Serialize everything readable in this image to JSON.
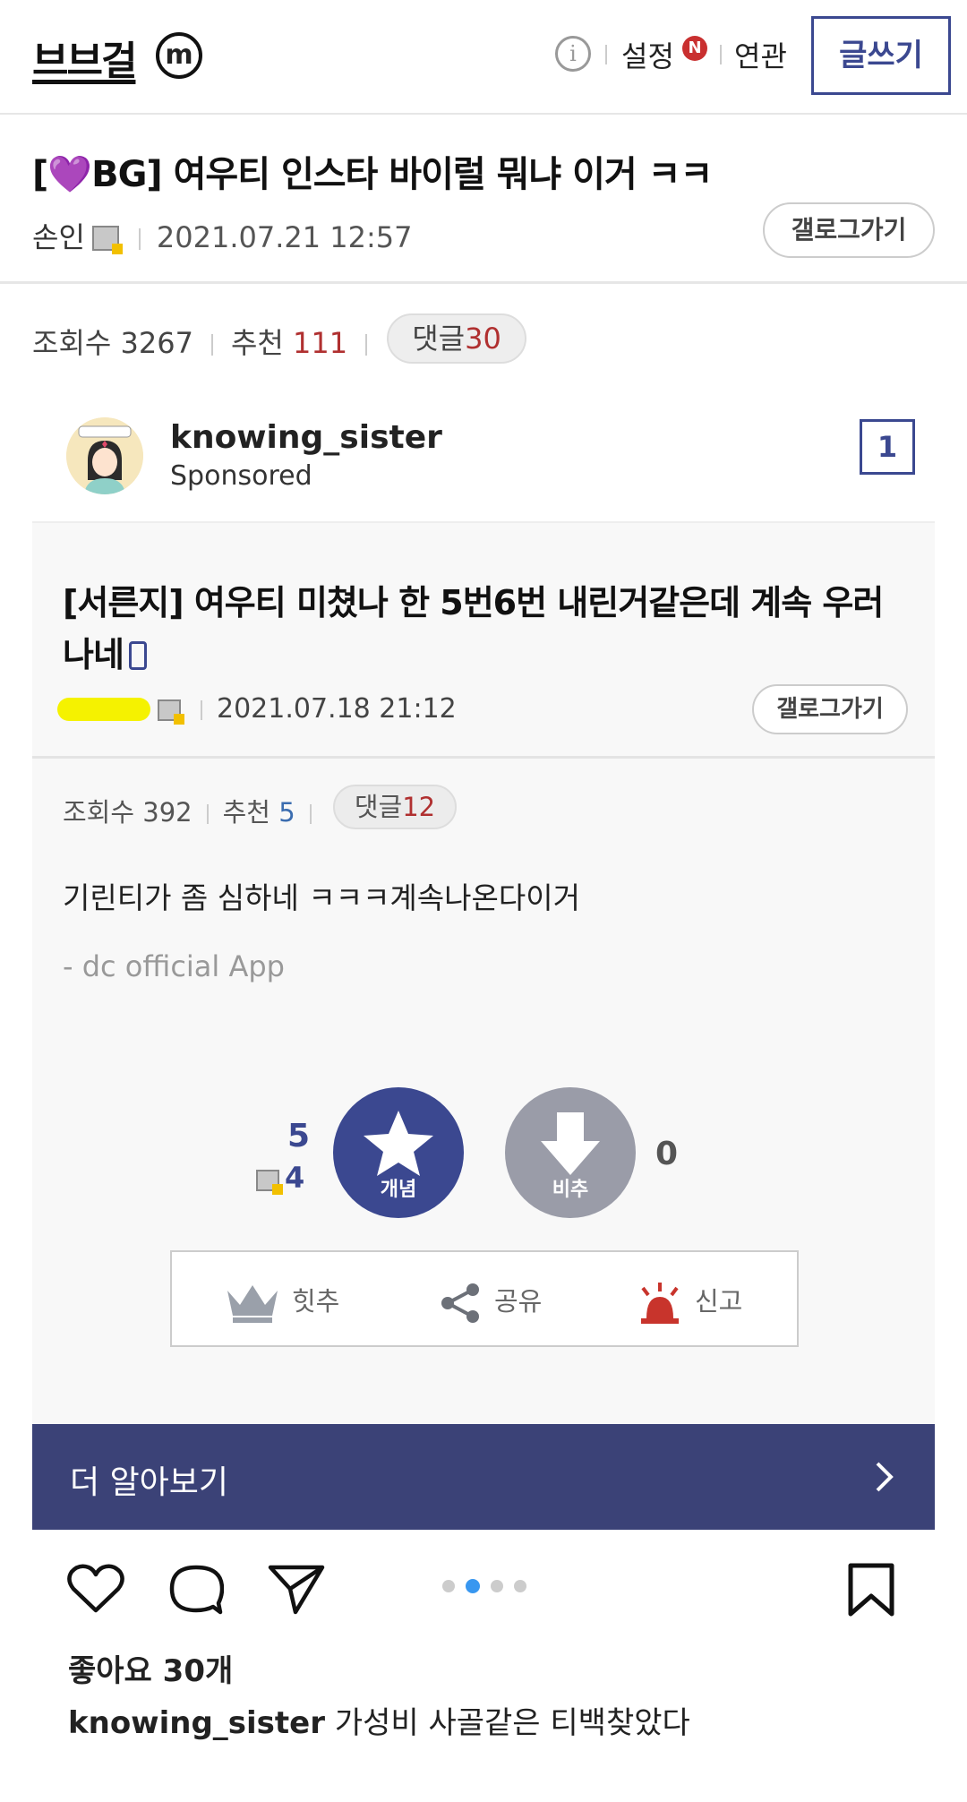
{
  "header": {
    "logo": "브브걸",
    "badge": "m",
    "info_icon": "i",
    "settings": "설정",
    "settings_badge": "N",
    "related": "연관",
    "write_button": "글쓰기"
  },
  "post": {
    "title_prefix": "[",
    "title_heart": "💜",
    "title_rest": "BG] 여우티 인스타 바이럴 뭐냐 이거 ㅋㅋ",
    "author": "손인",
    "date": "2021.07.21 12:57",
    "gallery_button": "갤로그가기",
    "views_label": "조회수",
    "views": "3267",
    "recommend_label": "추천",
    "recommend": "111",
    "comments_label": "댓글",
    "comments": "30"
  },
  "instagram": {
    "username": "knowing_sister",
    "sponsored": "Sponsored",
    "image_counter": "1",
    "more_button": "더 알아보기",
    "likes": "좋아요 30개",
    "caption_user": "knowing_sister",
    "caption_text": "가성비 사골같은 티백찾았다",
    "icons": [
      "heart-icon",
      "comment-icon",
      "share-icon",
      "bookmark-icon"
    ]
  },
  "embedded_post": {
    "title": "[서른지] 여우티 미쳤나 한 5번6번 내린거같은데 계속 우러나네",
    "date": "2021.07.18 21:12",
    "gallery_button": "갤로그가기",
    "views_label": "조회수",
    "views": "392",
    "recommend_label": "추천",
    "recommend": "5",
    "comments_label": "댓글",
    "comments": "12",
    "body": "기린티가 좀 심하네 ㅋㅋㅋ계속나온다이거",
    "app_sign": "- dc official App",
    "upvote_count": "5",
    "fixed_upvote_count": "4",
    "upvote_label": "개념",
    "downvote_label": "비추",
    "downvote_count": "0",
    "action_hit": "힛추",
    "action_share": "공유",
    "action_report": "신고"
  },
  "colors": {
    "accent": "#3b4890",
    "more_bar": "#3b4277",
    "red": "#b03030",
    "heart": "#9b51e0"
  }
}
